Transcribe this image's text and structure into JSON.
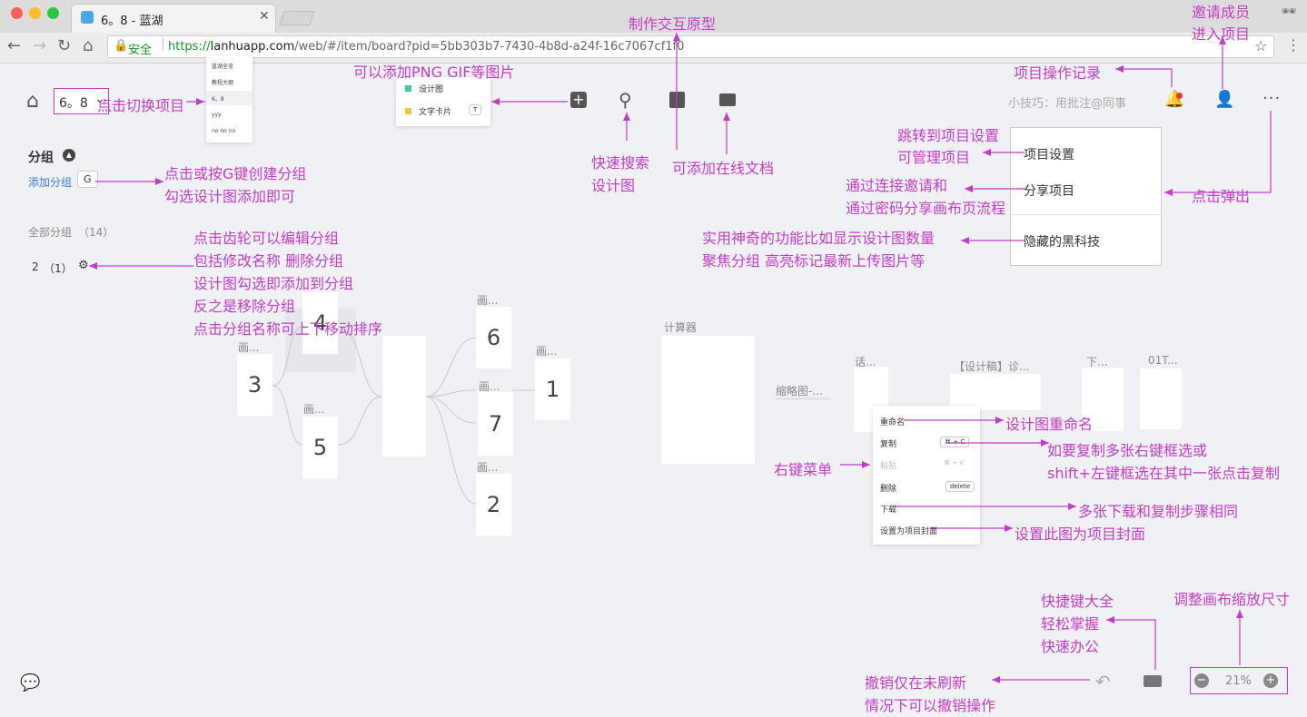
{
  "browser": {
    "tab_title": "6。8 - 蓝湖",
    "secure_label": "安全",
    "url_https": "https://",
    "url_host": "lanhuapp.com",
    "url_path": "/web/#/item/board?pid=5bb303b7-7430-4b8d-a24f-16c7067cf1f0"
  },
  "header": {
    "project_name": "6。8",
    "dropdown_items": [
      "蓝湖全览",
      "教程大纲",
      "6。8",
      "yyy",
      "no no no"
    ],
    "add_menu": {
      "item1": "设计图",
      "item2": "文字卡片",
      "item2_key": "T"
    },
    "tip": "小技巧：用批注@同事"
  },
  "sidebar": {
    "group_title": "分组",
    "add_group": "添加分组",
    "add_group_key": "G",
    "all_groups": "全部分组",
    "all_groups_count": "（14）",
    "group_name": "2",
    "group_count": "（1）"
  },
  "canvas": {
    "cards": [
      {
        "num": "3",
        "label": "画..."
      },
      {
        "num": "4",
        "label": ""
      },
      {
        "num": "5",
        "label": "画..."
      },
      {
        "num": "6",
        "label": "画..."
      },
      {
        "num": "7",
        "label": "画..."
      },
      {
        "num": "2",
        "label": "画..."
      },
      {
        "num": "1",
        "label": "画..."
      }
    ],
    "calculator_label": "计算器",
    "thumb_label": "缩略图-...",
    "labels_right": [
      "话...",
      "【设计稿】诊...",
      "下...",
      "01T..."
    ]
  },
  "project_menu": {
    "items": [
      "项目设置",
      "分享项目",
      "隐藏的黑科技"
    ]
  },
  "context_menu": {
    "rename": "重命名",
    "copy": "复制",
    "copy_key": "⌘ + C",
    "paste": "粘贴",
    "paste_key": "⌘ + V",
    "delete": "删除",
    "delete_key": "delete",
    "download": "下载",
    "set_cover": "设置为项目封面"
  },
  "zoom": {
    "value": "21%"
  },
  "annotations": {
    "switch_project": "点击切换项目",
    "add_png": "可以添加PNG GIF等图片",
    "prototype": "制作交互原型",
    "invite1": "邀请成员",
    "invite2": "进入项目",
    "record": "项目操作记录",
    "settings1": "跳转到项目设置",
    "settings2": "可管理项目",
    "share1": "通过连接邀请和",
    "share2": "通过密码分享画布页流程",
    "popup": "点击弹出",
    "black1": "实用神奇的功能比如显示设计图数量",
    "black2": "聚焦分组 高亮标记最新上传图片等",
    "create_group1": "点击或按G键创建分组",
    "create_group2": "勾选设计图添加即可",
    "search1": "快速搜索",
    "search2": "设计图",
    "online_doc": "可添加在线文档",
    "gear1": "点击齿轮可以编辑分组",
    "gear2": "包括修改名称 删除分组",
    "gear3": "设计图勾选即添加到分组",
    "gear4": "反之是移除分组",
    "gear5": "点击分组名称可上下移动排序",
    "rename": "设计图重命名",
    "copy1": "如要复制多张右键框选或",
    "copy2": "shift+左键框选在其中一张点击复制",
    "right_menu": "右键菜单",
    "download": "多张下载和复制步骤相同",
    "cover": "设置此图为项目封面",
    "shortcut1": "快捷键大全",
    "shortcut2": "轻松掌握",
    "shortcut3": "快速办公",
    "zoom_adj": "调整画布缩放尺寸",
    "undo1": "撤销仅在未刷新",
    "undo2": "情况下可以撤销操作"
  }
}
